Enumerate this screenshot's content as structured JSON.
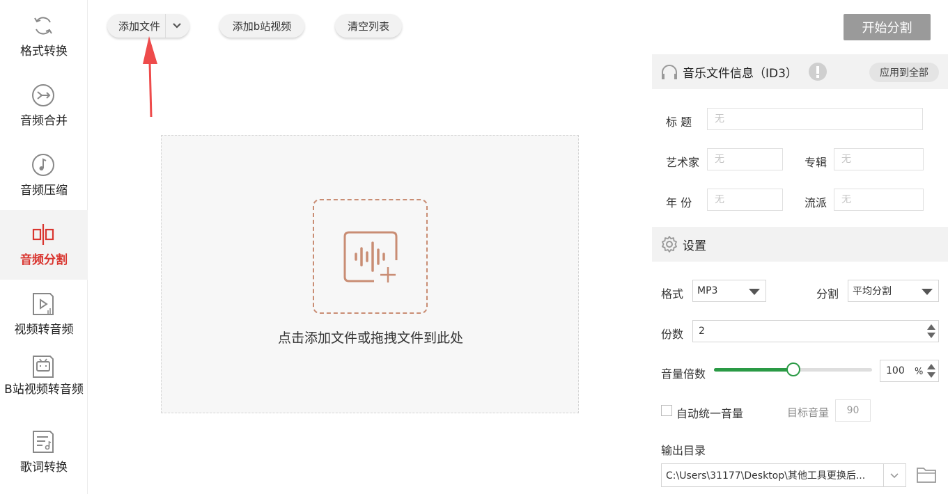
{
  "sidebar": {
    "items": [
      {
        "label": "格式转换",
        "icon": "refresh-icon"
      },
      {
        "label": "音频合并",
        "icon": "merge-icon"
      },
      {
        "label": "音频压缩",
        "icon": "music-note-icon"
      },
      {
        "label": "音频分割",
        "icon": "split-icon"
      },
      {
        "label": "视频转音频",
        "icon": "video-play-icon"
      },
      {
        "label": "B站视频转音频",
        "icon": "bilibili-tv-icon"
      },
      {
        "label": "歌词转换",
        "icon": "lyrics-icon"
      }
    ],
    "active_index": 3
  },
  "toolbar": {
    "add_file_label": "添加文件",
    "add_bili_label": "添加b站视频",
    "clear_label": "清空列表",
    "start_label": "开始分割"
  },
  "dropzone": {
    "hint": "点击添加文件或拖拽文件到此处"
  },
  "id3": {
    "title": "音乐文件信息（ID3）",
    "apply_all": "应用到全部",
    "labels": {
      "title": "标  题",
      "artist": "艺术家",
      "album": "专辑",
      "year": "年  份",
      "genre": "流派"
    },
    "placeholder": "无"
  },
  "settings": {
    "title": "设置",
    "format_label": "格式",
    "format_value": "MP3",
    "split_label": "分割",
    "split_value": "平均分割",
    "parts_label": "份数",
    "parts_value": "2",
    "volume_label": "音量倍数",
    "volume_value": "100",
    "volume_unit": "%",
    "volume_fraction": 0.5,
    "auto_volume_label": "自动统一音量",
    "auto_volume_checked": false,
    "target_volume_label": "目标音量",
    "target_volume_value": "90",
    "output_label": "输出目录",
    "output_path": "C:\\Users\\31177\\Desktop\\其他工具更换后..."
  },
  "colors": {
    "accent": "#d9352f",
    "slider": "#2a9a45",
    "drop_border": "#c98d74",
    "start_button": "#9a9a9a",
    "annotation_arrow": "#ee4b4b"
  }
}
